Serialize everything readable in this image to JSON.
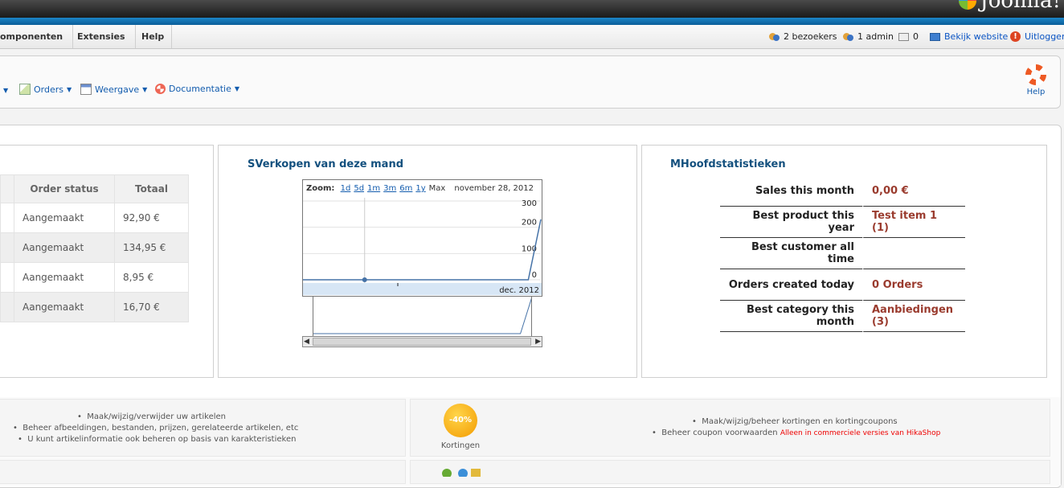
{
  "brand": {
    "logo_text": "Joomla!"
  },
  "menubar": {
    "items": [
      "omponenten",
      "Extensies",
      "Help"
    ],
    "status": {
      "visitors": "2 bezoekers",
      "admins": "1 admin",
      "messages": "0",
      "view_site": "Bekijk website",
      "logout": "Uitloggen"
    }
  },
  "toolbar": {
    "items": [
      "Orders",
      "Weergave",
      "Documentatie"
    ],
    "help": "Help"
  },
  "orders_panel": {
    "columns": [
      "Order status",
      "Totaal"
    ],
    "rows": [
      [
        "Aangemaakt",
        "92,90 €"
      ],
      [
        "Aangemaakt",
        "134,95 €"
      ],
      [
        "Aangemaakt",
        "8,95 €"
      ],
      [
        "Aangemaakt",
        "16,70 €"
      ]
    ]
  },
  "sales_panel": {
    "title": "SVerkopen van deze mand",
    "zoom_label": "Zoom:",
    "zoom_options": [
      "1d",
      "5d",
      "1m",
      "3m",
      "6m",
      "1y",
      "Max"
    ],
    "date_label": "november 28, 2012"
  },
  "chart_data": {
    "type": "line",
    "x": [
      "2012-11-22",
      "2012-11-28",
      "2012-12-04",
      "2012-12-10",
      "2012-12-16",
      "2012-12-22",
      "2012-12-28",
      "2012-12-30"
    ],
    "series": [
      {
        "values": [
          0,
          0,
          0,
          0,
          0,
          0,
          0,
          230
        ]
      }
    ],
    "yticks": [
      "300",
      "200",
      "100",
      "0"
    ],
    "ylim": [
      0,
      300
    ],
    "xtick_label": "dec. 2012",
    "highlight_date": "november 28, 2012",
    "color": "#4572a7"
  },
  "stats_panel": {
    "title": "MHoofdstatistieken",
    "rows": [
      {
        "label": "Sales this month",
        "value": "0,00 €"
      },
      {
        "label": "Best product this year",
        "value": "Test item 1 (1)"
      },
      {
        "label": "Best customer all time",
        "value": ""
      },
      {
        "label": "Orders created today",
        "value": "0 Orders"
      },
      {
        "label": "Best category this month",
        "value": "Aanbiedingen (3)"
      }
    ]
  },
  "bottom": {
    "products_bullets": [
      "Maak/wijzig/verwijder uw artikelen",
      "Beheer afbeeldingen, bestanden, prijzen, gerelateerde artikelen, etc",
      "U kunt artikelinformatie ook beheren op basis van karakteristieken"
    ],
    "discount_badge": "-40%",
    "discount_label": "Kortingen",
    "discount_bullets": [
      "Maak/wijzig/beheer kortingen en kortingcoupons",
      "Beheer coupon voorwaarden"
    ],
    "discount_note": "Alleen in commerciele versies van HikaShop"
  }
}
